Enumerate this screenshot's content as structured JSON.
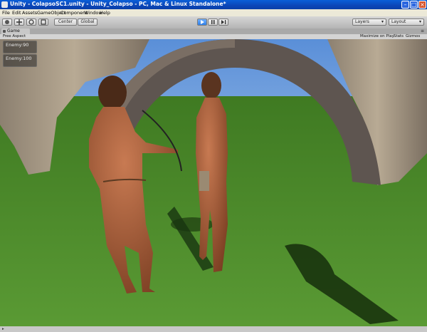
{
  "window": {
    "title": "Unity - ColapsoSC1.unity - Unity_Colapso - PC, Mac & Linux Standalone*"
  },
  "menu": [
    "File",
    "Edit",
    "Assets",
    "GameObject",
    "Component",
    "Window",
    "Help"
  ],
  "toolbar": {
    "center_label": "Center",
    "global_label": "Global",
    "layers_label": "Layers",
    "layout_label": "Layout"
  },
  "game_tab": {
    "label": "Game"
  },
  "game_bar": {
    "aspect": "Free Aspect",
    "maximize": "Maximize on Play",
    "stats": "Stats",
    "gizmos": "Gizmos"
  },
  "hud": {
    "enemy1": "Enemy:90",
    "enemy2": "Enemy:100"
  },
  "colors": {
    "titlebar": "#0b46b8",
    "sky": "#7fb0e8",
    "grass": "#4a8a28",
    "stone": "#a89a86",
    "skin": "#a25a36"
  }
}
